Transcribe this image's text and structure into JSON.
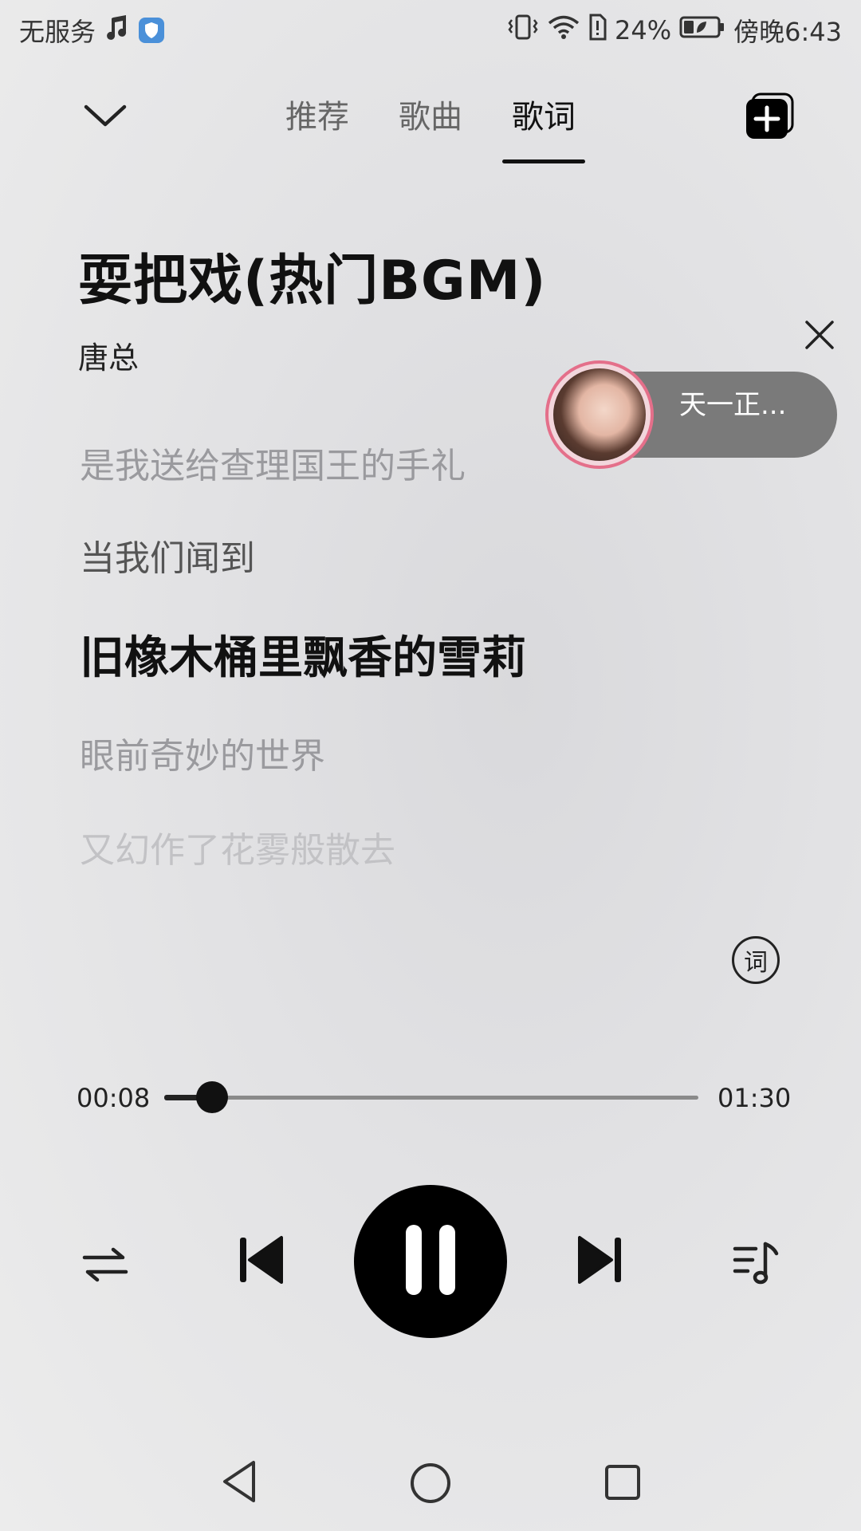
{
  "status_bar": {
    "carrier": "无服务",
    "battery": "24%",
    "time": "傍晚6:43"
  },
  "tabs": [
    {
      "label": "推荐",
      "active": false
    },
    {
      "label": "歌曲",
      "active": false
    },
    {
      "label": "歌词",
      "active": true
    }
  ],
  "song": {
    "title": "耍把戏(热门BGM)",
    "artist": "唐总"
  },
  "floating": {
    "name": "天一正..."
  },
  "lyrics": [
    "是我送给查理国王的手礼",
    "当我们闻到",
    "旧橡木桶里飘香的雪莉",
    "眼前奇妙的世界",
    "又幻作了花雾般散去"
  ],
  "lyric_mode_label": "词",
  "progress": {
    "current": "00:08",
    "total": "01:30",
    "fraction": 0.089
  },
  "colors": {
    "accent": "#111111",
    "float_ring": "#e46f8a",
    "float_pill": "#7a7a7a"
  }
}
